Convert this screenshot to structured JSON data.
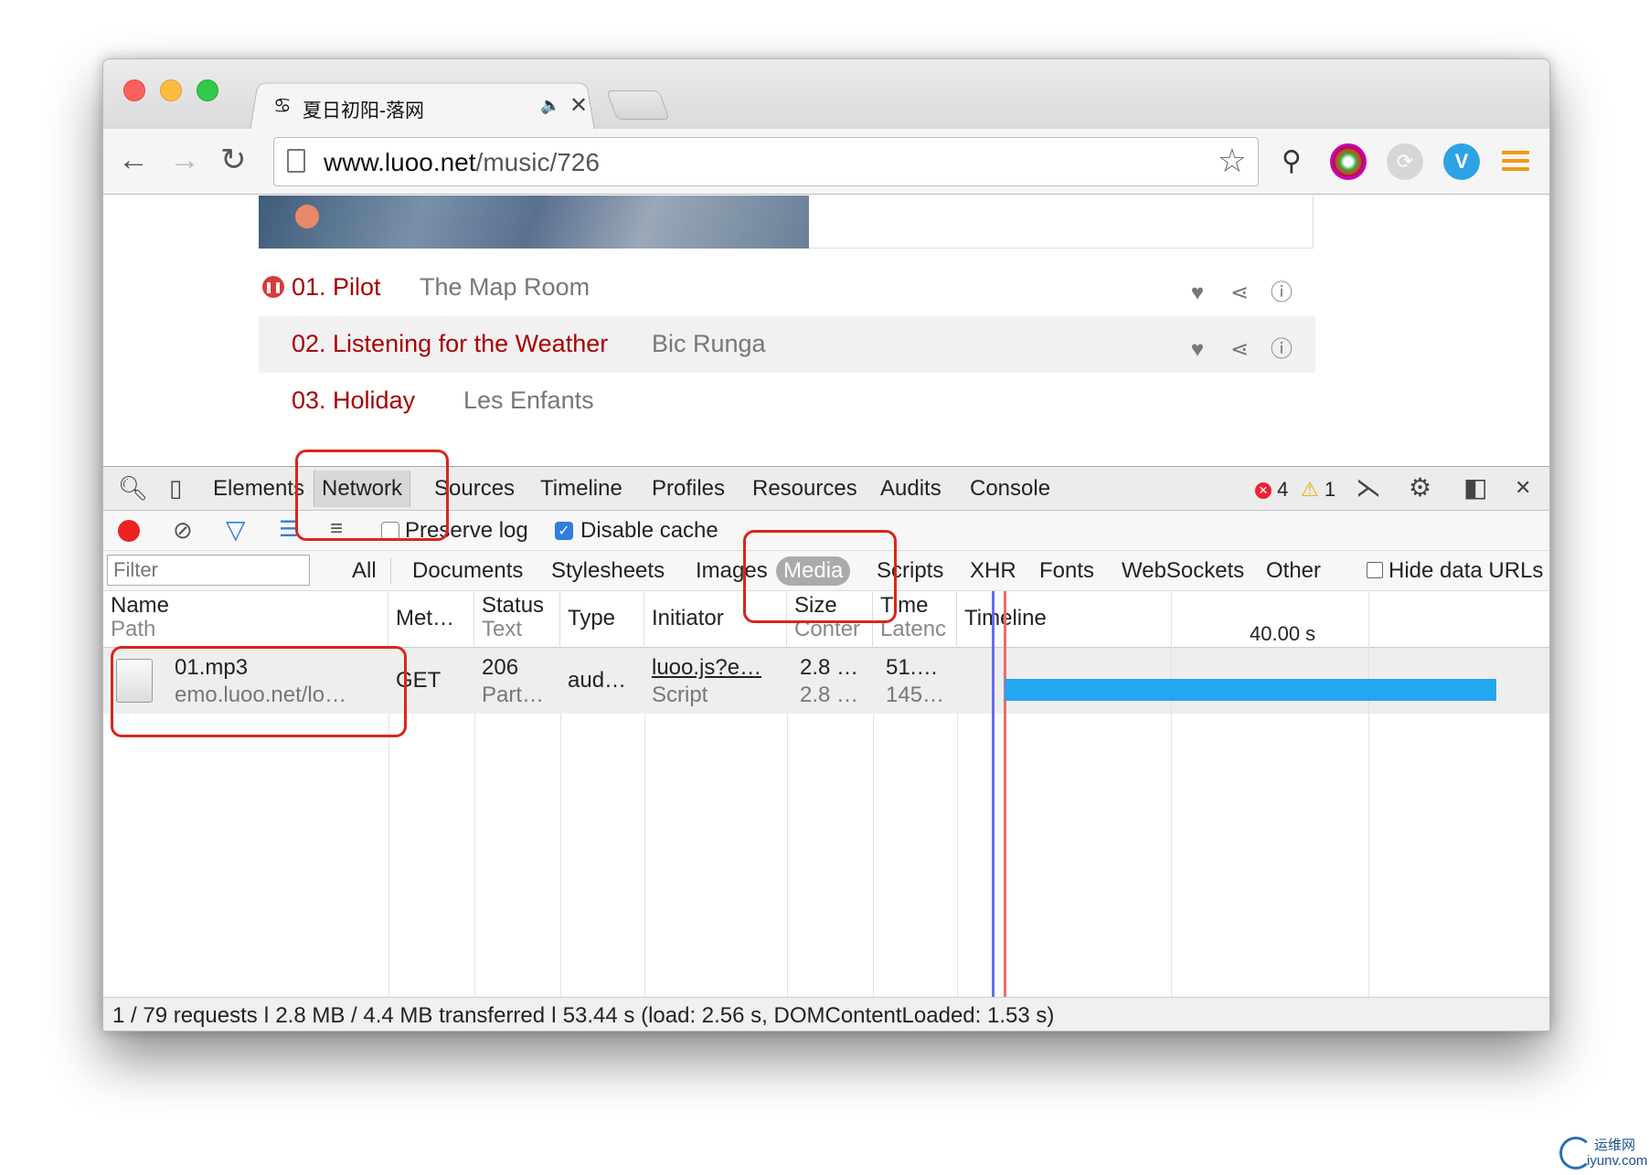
{
  "browser": {
    "tab": {
      "title": "夏日初阳-落网",
      "favicon": "swallow-favicon",
      "audio_icon": "speaker-icon",
      "close": "✕"
    },
    "url": {
      "host": "www.luoo.net",
      "path": "/music/726"
    },
    "extensions": [
      "lamp-icon",
      "color-picker-icon",
      "sync-icon",
      "v-icon",
      "menu-icon"
    ]
  },
  "page": {
    "songs": [
      {
        "title": "01. Pilot",
        "artist": "The Map Room",
        "playing": true
      },
      {
        "title": "02. Listening for the Weather",
        "artist": "Bic Runga",
        "playing": false
      },
      {
        "title": "03. Holiday",
        "artist": "Les Enfants",
        "playing": false
      }
    ]
  },
  "devtools": {
    "tabs": [
      "Elements",
      "Network",
      "Sources",
      "Timeline",
      "Profiles",
      "Resources",
      "Audits",
      "Console"
    ],
    "selected_tab": "Network",
    "errors": "4",
    "warnings": "1",
    "toolbar": {
      "preserve_log": "Preserve log",
      "disable_cache": "Disable cache"
    },
    "filter": {
      "placeholder": "Filter",
      "types": [
        "All",
        "Documents",
        "Stylesheets",
        "Images",
        "Media",
        "Scripts",
        "XHR",
        "Fonts",
        "WebSockets",
        "Other"
      ],
      "active": "Media",
      "hide_data_urls": "Hide data URLs"
    },
    "columns": {
      "name": {
        "l1": "Name",
        "l2": "Path"
      },
      "method": "Met…",
      "status": {
        "l1": "Status",
        "l2": "Text"
      },
      "type": "Type",
      "initiator": "Initiator",
      "size": {
        "l1": "Size",
        "l2": "Conter"
      },
      "time": {
        "l1": "Time",
        "l2": "Latenc"
      },
      "timeline": "Timeline",
      "scale": "40.00 s"
    },
    "row": {
      "name": "01.mp3",
      "path": "emo.luoo.net/lo…",
      "method": "GET",
      "status": "206",
      "status_text": "Part…",
      "type": "aud…",
      "initiator": "luoo.js?e…",
      "initiator_type": "Script",
      "size": "2.8 …",
      "content": "2.8 …",
      "time": "51.…",
      "latency": "145…"
    },
    "status_bar": "1 / 79 requests ǀ 2.8 MB / 4.4 MB transferred ǀ 53.44 s (load: 2.56 s, DOMContentLoaded: 1.53 s)"
  },
  "watermark": {
    "cn": "运维网",
    "en": "iyunv.com"
  }
}
